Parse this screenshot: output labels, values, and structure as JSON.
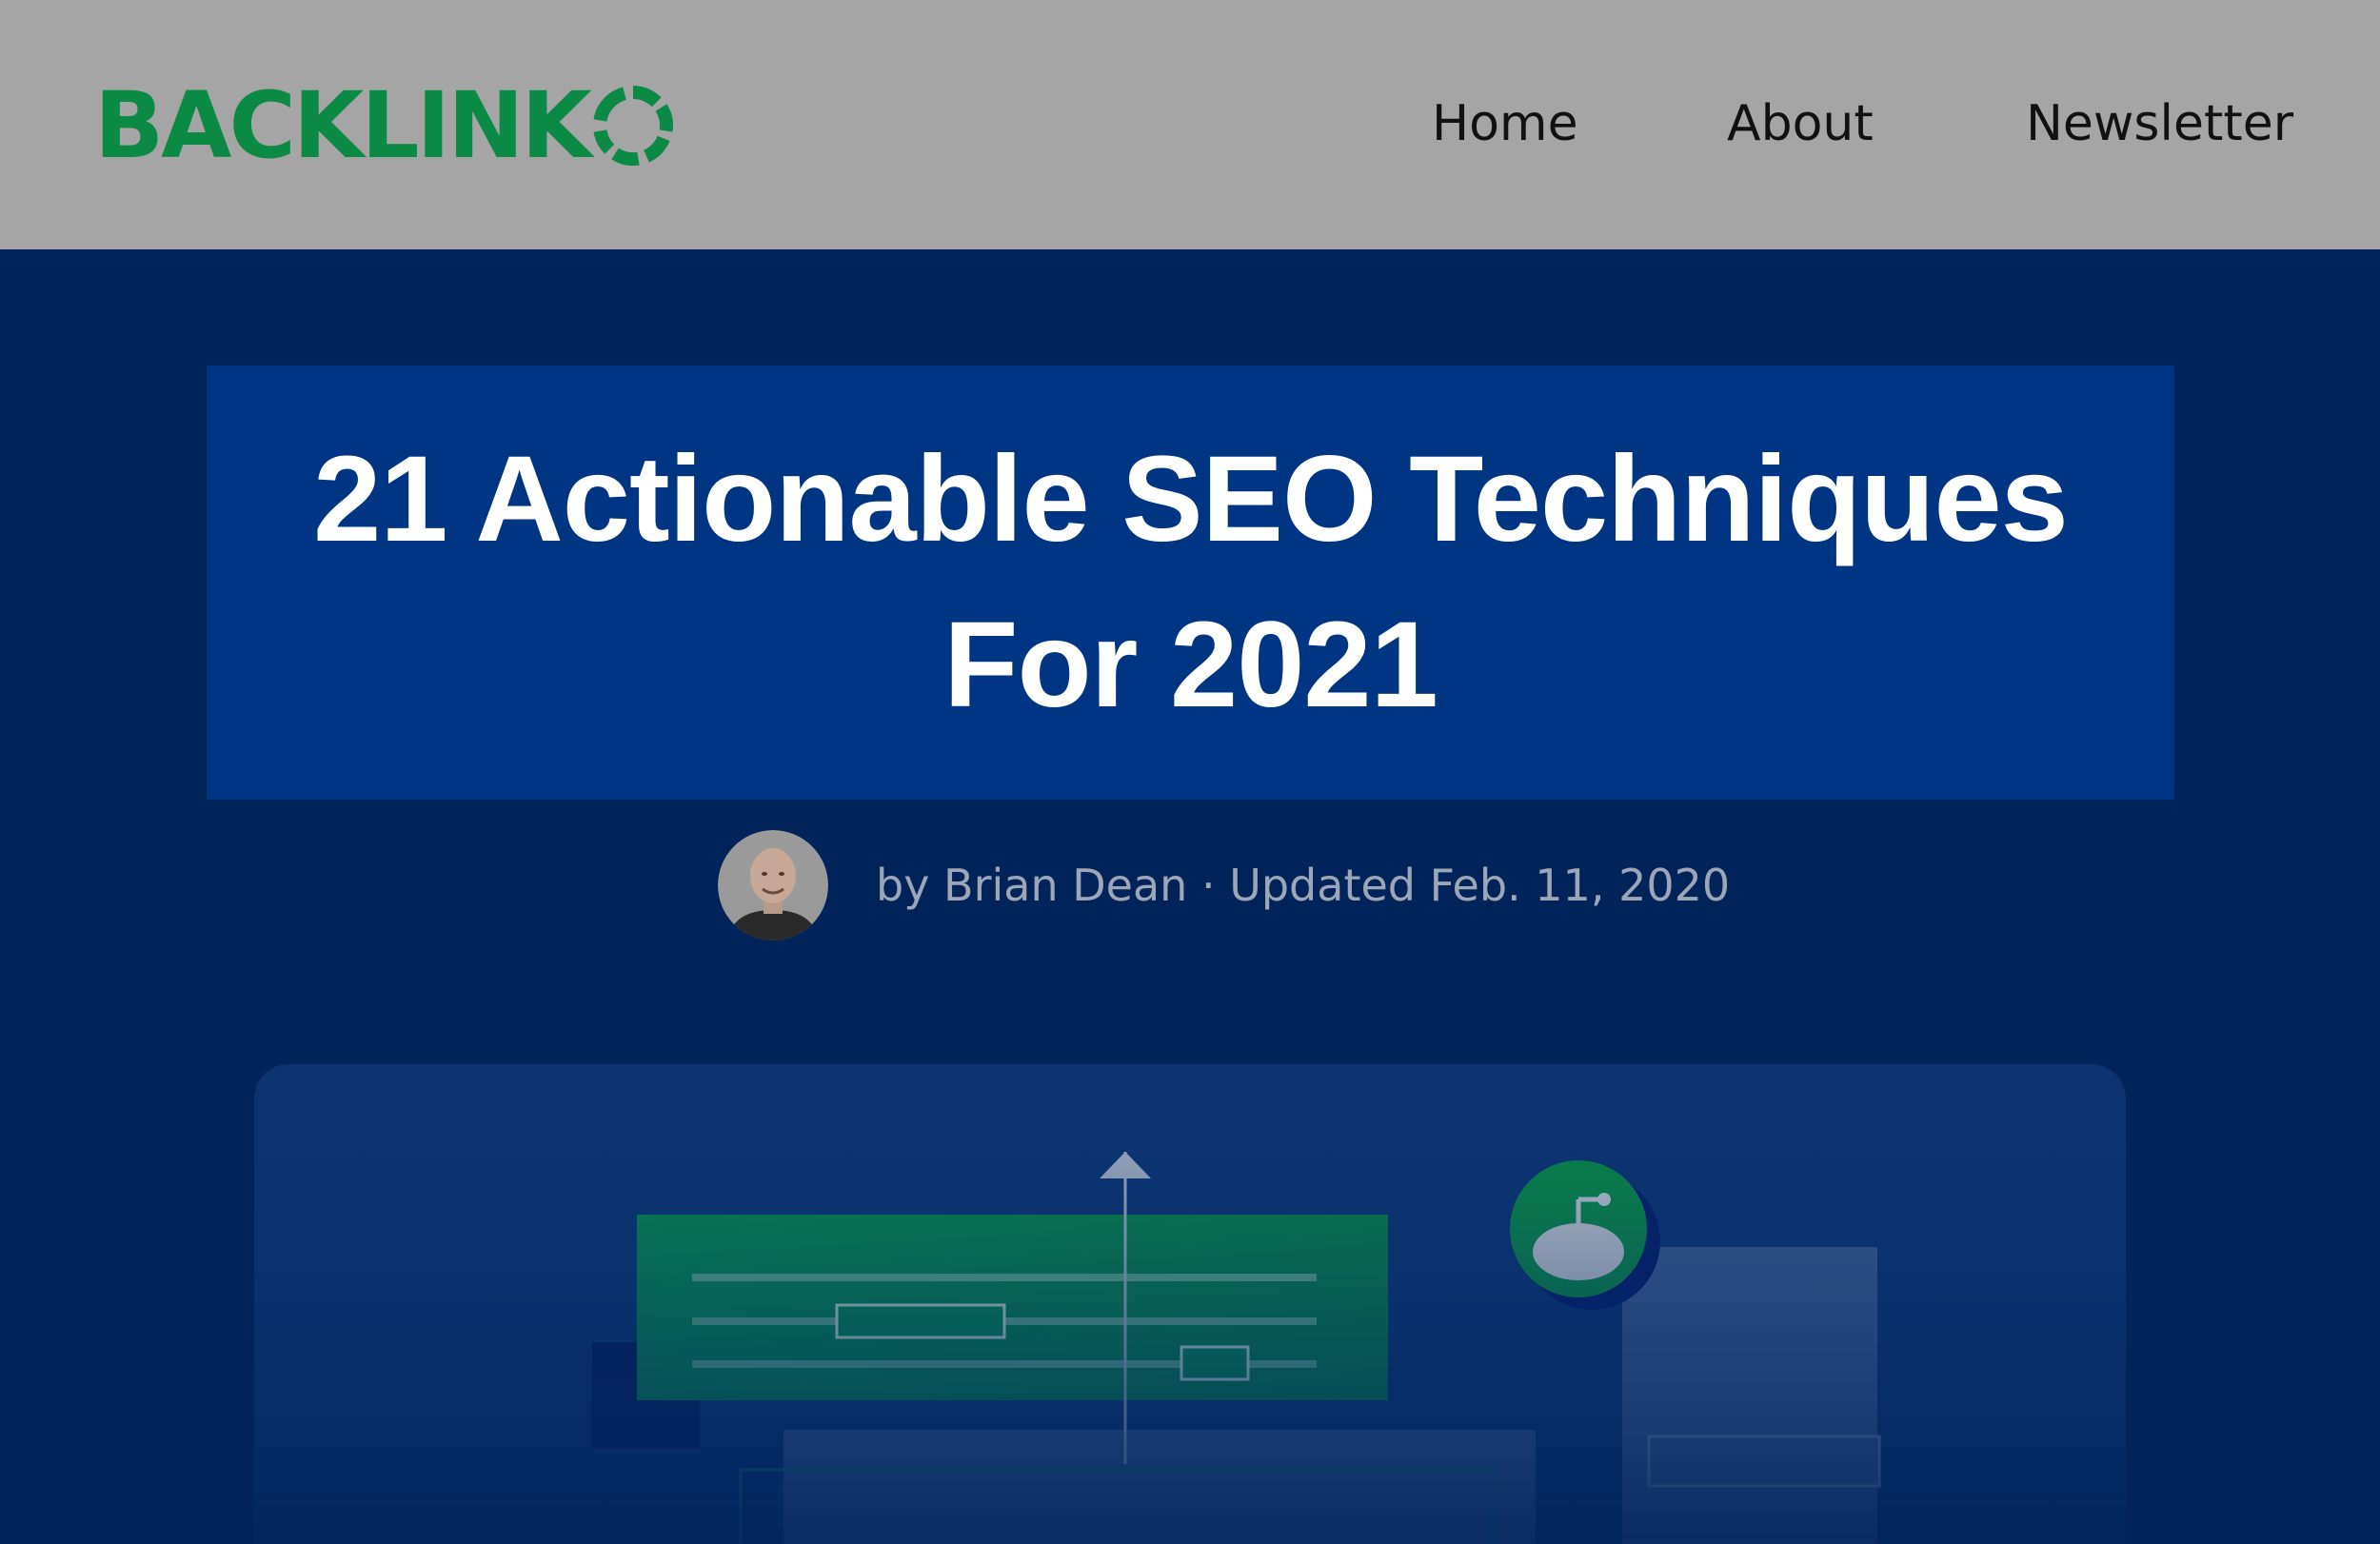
{
  "header": {
    "logo_text": "BACKLINK",
    "logo_icon": "ring-o-icon",
    "brand_color": "#0b8a45",
    "nav": [
      {
        "label": "Home"
      },
      {
        "label": "About"
      },
      {
        "label": "Newsletter"
      }
    ]
  },
  "article": {
    "title": "21 Actionable SEO Techniques For 2021",
    "byline": "by Brian Dean · Updated Feb. 11, 2020"
  },
  "colors": {
    "page_background": "#00245a",
    "header_background": "#a5a5a5",
    "title_background": "#003584",
    "accent_green": "#0b8a45"
  }
}
